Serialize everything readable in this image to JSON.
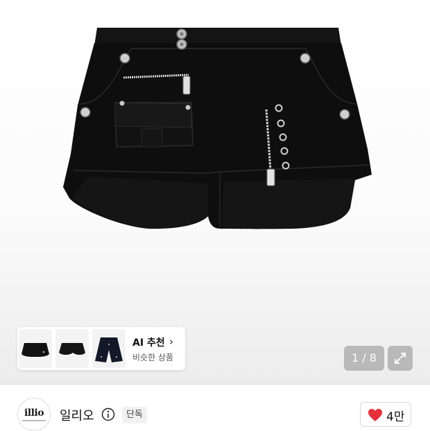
{
  "gallery": {
    "product_image_icon": "black-cargo-skort-with-zippers-and-eyelets",
    "recommendation": {
      "title": "AI 추천",
      "subtitle": "비슷한 상품",
      "thumbnails": [
        "black-mini-skort-thumb",
        "black-shorts-thumb",
        "navy-studded-shorts-thumb"
      ]
    },
    "counter": "1 / 8",
    "expand_icon": "expand-arrows-icon"
  },
  "seller": {
    "logo_text": "illio",
    "name": "일리오",
    "badge": "단독",
    "like_count": "4만"
  },
  "colors": {
    "heart": "#e8303a",
    "overlay": "#787878"
  }
}
